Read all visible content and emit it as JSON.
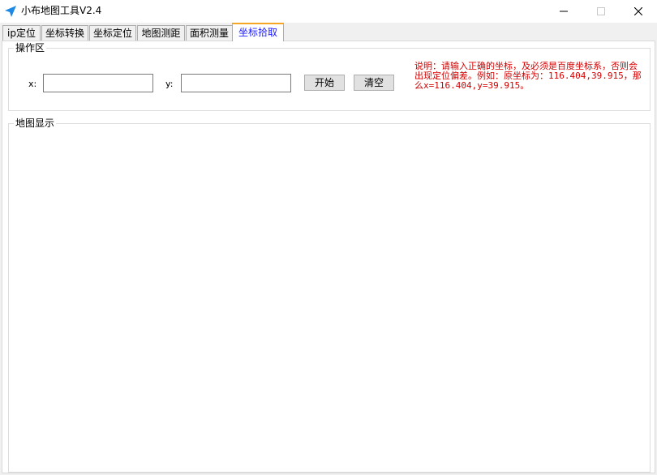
{
  "window": {
    "title": "小布地图工具V2.4",
    "icon": "navigation-arrow-icon",
    "controls": [
      "minimize-icon",
      "maximize-icon",
      "close-icon"
    ]
  },
  "tabs": [
    {
      "label": "ip定位",
      "active": false
    },
    {
      "label": "坐标转换",
      "active": false
    },
    {
      "label": "坐标定位",
      "active": false
    },
    {
      "label": "地图测距",
      "active": false
    },
    {
      "label": "面积测量",
      "active": false
    },
    {
      "label": "坐标拾取",
      "active": true
    }
  ],
  "operation": {
    "legend": "操作区",
    "x_label": "x:",
    "x_value": "",
    "y_label": "y:",
    "y_value": "",
    "start_label": "开始",
    "clear_label": "清空",
    "note": "说明：请输入正确的坐标，及必须是百度坐标系，否则会出现定位偏差。例如：原坐标为：116.404,39.915，那么x=116.404,y=39.915。"
  },
  "map": {
    "legend": "地图显示"
  },
  "colors": {
    "note_text": "#d40000",
    "active_tab_text": "#1a1aff",
    "active_tab_accent": "#f5a623",
    "app_icon": "#1e88e5"
  }
}
